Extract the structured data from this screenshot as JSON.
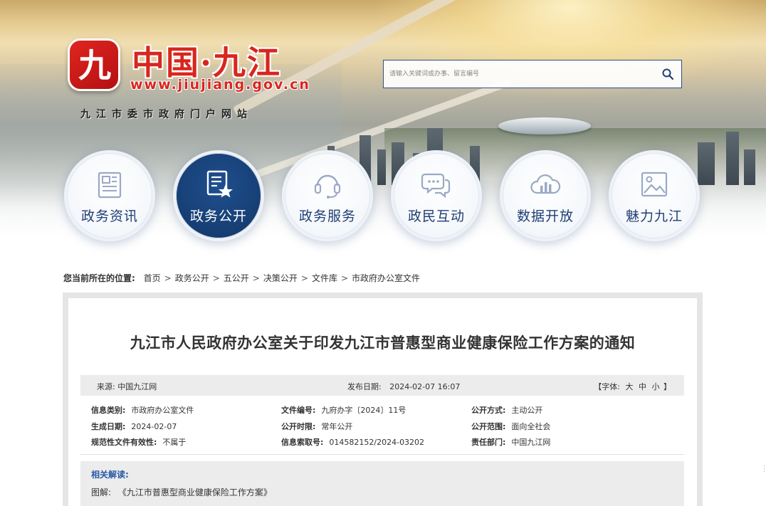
{
  "header": {
    "logo_glyph": "九",
    "title": "中国·九江",
    "url": "www.jiujiang.gov.cn",
    "subtitle": "九江市委市政府门户网站",
    "brand_color": "#d8261e"
  },
  "search": {
    "placeholder": "请输入关键词或办事、留言编号",
    "button_icon": "search-icon"
  },
  "nav": [
    {
      "label": "政务资讯",
      "icon": "newspaper-icon",
      "active": false
    },
    {
      "label": "政务公开",
      "icon": "document-star-icon",
      "active": true
    },
    {
      "label": "政务服务",
      "icon": "headset-icon",
      "active": false
    },
    {
      "label": "政民互动",
      "icon": "chat-bubbles-icon",
      "active": false
    },
    {
      "label": "数据开放",
      "icon": "cloud-chart-icon",
      "active": false
    },
    {
      "label": "魅力九江",
      "icon": "picture-icon",
      "active": false
    }
  ],
  "breadcrumb": {
    "label": "您当前所在的位置:",
    "items": [
      "首页",
      "政务公开",
      "五公开",
      "决策公开",
      "文件库",
      "市政府办公室文件"
    ],
    "separator": ">"
  },
  "article": {
    "title": "九江市人民政府办公室关于印发九江市普惠型商业健康保险工作方案的通知",
    "source_label": "来源:",
    "source": "中国九江网",
    "pub_label": "发布日期:",
    "pub_date": "2024-02-07 16:07",
    "font_label": "【字体:",
    "font_large": "大",
    "font_medium": "中",
    "font_small": "小",
    "font_end": "】"
  },
  "info": {
    "category_k": "信息类别:",
    "category_v": "市政府办公室文件",
    "docno_k": "文件编号:",
    "docno_v": "九府办字〔2024〕11号",
    "method_k": "公开方式:",
    "method_v": "主动公开",
    "date_k": "生成日期:",
    "date_v": "2024-02-07",
    "period_k": "公开时限:",
    "period_v": "常年公开",
    "scope_k": "公开范围:",
    "scope_v": "面向全社会",
    "validity_k": "规范性文件有效性:",
    "validity_v": "不属于",
    "index_k": "信息索取号:",
    "index_v": "014582152/2024-03202",
    "dept_k": "责任部门:",
    "dept_v": "中国九江网"
  },
  "related": {
    "heading": "相关解读:",
    "prefix": "图解:",
    "link": "《九江市普惠型商业健康保险工作方案》"
  },
  "colors": {
    "nav_active": "#163e73",
    "nav_text": "#1f3f75",
    "related_heading": "#2b5aa8"
  }
}
